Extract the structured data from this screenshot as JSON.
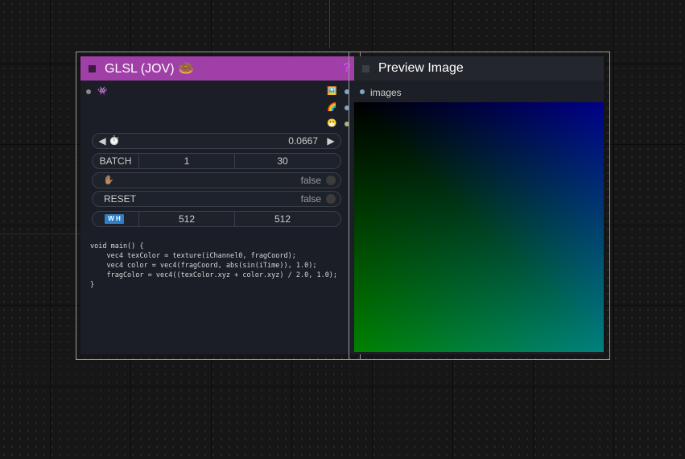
{
  "glsl_node": {
    "title": "GLSL (JOV) 🍩",
    "input_icon": "👾",
    "outputs": [
      "🖼️",
      "🌈",
      "😷"
    ],
    "time": {
      "icon": "⏱️",
      "value": "0.0667",
      "left": "◀",
      "right": "▶"
    },
    "batch": {
      "label": "BATCH",
      "count": "1",
      "fps": "30"
    },
    "wait": {
      "icon": "✋🏽",
      "value": "false"
    },
    "reset": {
      "label": "RESET",
      "value": "false"
    },
    "wh": {
      "label": "W H",
      "width": "512",
      "height": "512"
    },
    "code": "void main() {\n    vec4 texColor = texture(iChannel0, fragCoord);\n    vec4 color = vec4(fragCoord, abs(sin(iTime)), 1.0);\n    fragColor = vec4((texColor.xyz + color.xyz) / 2.0, 1.0);\n}",
    "overlap_glyph": "?",
    "accent": "#a03fa8"
  },
  "preview_node": {
    "title": "Preview Image",
    "input_label": "images",
    "header_color": "#23262d"
  }
}
